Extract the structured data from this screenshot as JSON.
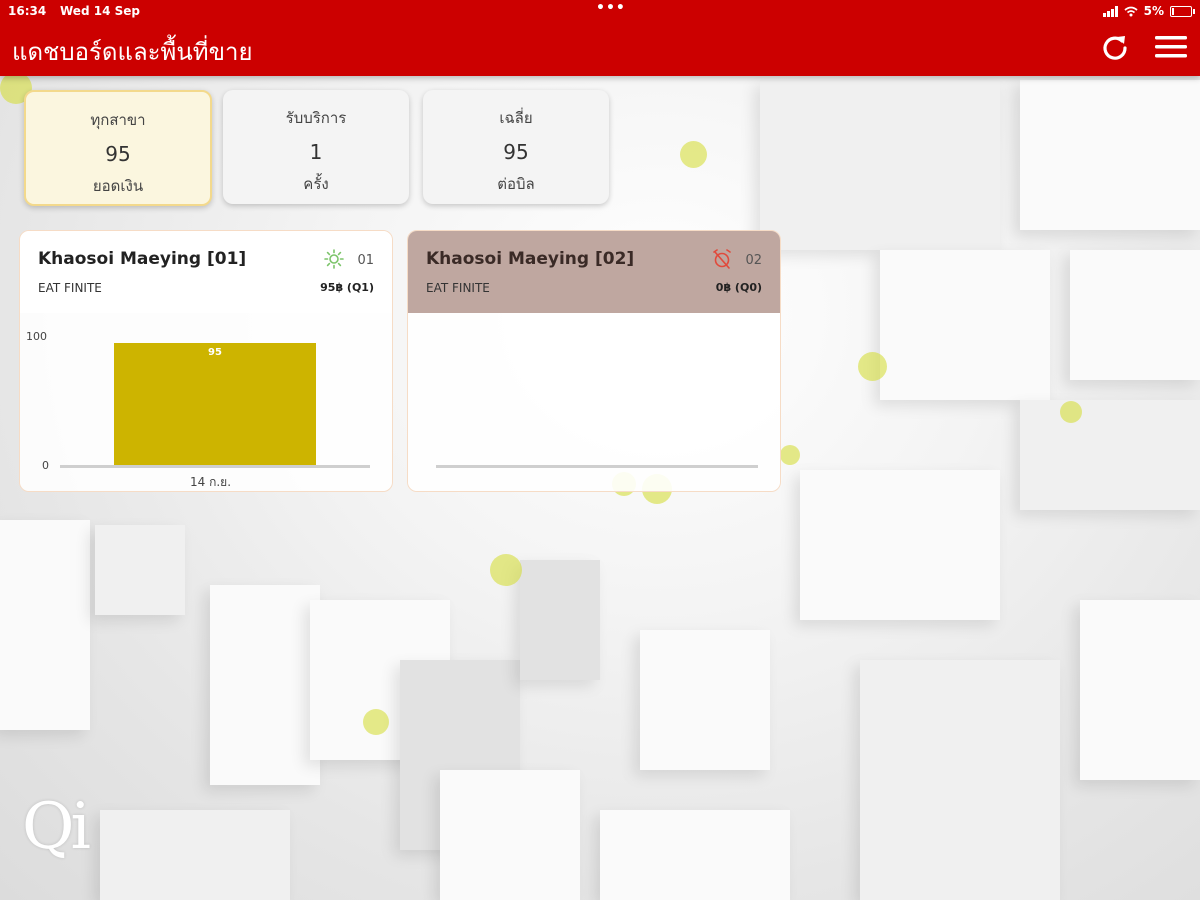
{
  "status_bar": {
    "time": "16:34",
    "date": "Wed 14 Sep",
    "dots": "•••",
    "battery": "5%"
  },
  "header": {
    "title": "แดชบอร์ดและพื้นที่ขาย",
    "refresh_icon": "refresh-icon",
    "menu_icon": "hamburger-menu-icon",
    "color": "#cc0000"
  },
  "summary": [
    {
      "label": "ทุกสาขา",
      "value": "95",
      "unit": "ยอดเงิน",
      "active": true
    },
    {
      "label": "รับบริการ",
      "value": "1",
      "unit": "ครั้ง",
      "active": false
    },
    {
      "label": "เฉลี่ย",
      "value": "95",
      "unit": "ต่อบิล",
      "active": false
    }
  ],
  "stores": [
    {
      "name": "Khaosoi Maeying [01]",
      "subtitle": "EAT FINITE",
      "code": "01",
      "stats": "95฿ (Q1)",
      "status_icon": "sun-open-icon",
      "status_color": "#7cc46a",
      "chart_data": {
        "type": "bar",
        "categories": [
          "14 ก.ย."
        ],
        "values": [
          95
        ],
        "data_labels": [
          "95"
        ],
        "ylim": [
          0,
          100
        ],
        "yticks": [
          "0",
          "100"
        ],
        "bar_color": "#cdb400"
      }
    },
    {
      "name": "Khaosoi Maeying [02]",
      "subtitle": "EAT FINITE",
      "code": "02",
      "stats": "0฿ (Q0)",
      "status_icon": "alarm-off-icon",
      "status_color": "#e14a3c",
      "chart_data": {
        "type": "bar",
        "categories": [],
        "values": []
      }
    }
  ],
  "logo": {
    "text": "Qi"
  },
  "colors": {
    "accent_yellow": "#cdb400",
    "card_closed": "#bfa7a0"
  }
}
